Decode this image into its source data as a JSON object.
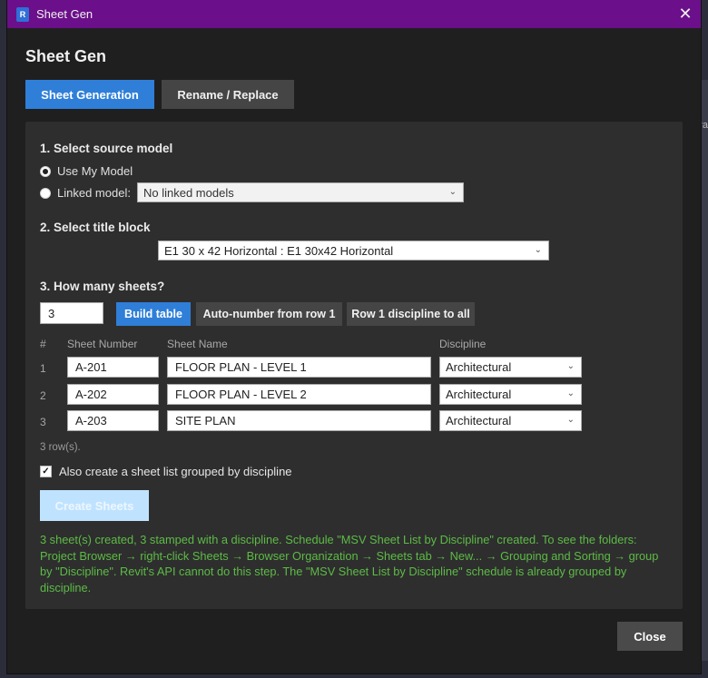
{
  "window": {
    "title": "Sheet Gen",
    "icon_letter": "R",
    "close_glyph": "✕"
  },
  "heading": "Sheet Gen",
  "tabs": [
    {
      "label": "Sheet Generation",
      "active": true
    },
    {
      "label": "Rename / Replace",
      "active": false
    }
  ],
  "section1": {
    "title": "1.  Select source model",
    "use_my_model": "Use My Model",
    "linked_model_label": "Linked model:",
    "linked_model_value": "No linked models",
    "selected": "use_my_model"
  },
  "section2": {
    "title": "2.  Select title block",
    "title_block_value": "E1 30 x 42 Horizontal : E1 30x42 Horizontal"
  },
  "section3": {
    "title": "3.  How many sheets?",
    "count_value": "3",
    "build_table": "Build table",
    "auto_number": "Auto-number from row 1",
    "row1_discipline": "Row 1 discipline to all"
  },
  "table": {
    "columns": {
      "num": "#",
      "sheet_number": "Sheet Number",
      "sheet_name": "Sheet Name",
      "discipline": "Discipline"
    },
    "rows": [
      {
        "num": "1",
        "sheet_number": "A-201",
        "sheet_name": "FLOOR PLAN - LEVEL 1",
        "discipline": "Architectural"
      },
      {
        "num": "2",
        "sheet_number": "A-202",
        "sheet_name": "FLOOR PLAN - LEVEL 2",
        "discipline": "Architectural"
      },
      {
        "num": "3",
        "sheet_number": "A-203",
        "sheet_name": "SITE PLAN",
        "discipline": "Architectural"
      }
    ],
    "row_count": "3 row(s)."
  },
  "options": {
    "sheet_list_label": "Also create a sheet list grouped by discipline",
    "sheet_list_checked": true
  },
  "create_button": "Create Sheets",
  "status_message": "3 sheet(s) created, 3 stamped with a discipline.   Schedule \"MSV Sheet List by Discipline\" created.   To see the folders: Project Browser → right-click Sheets → Browser Organization → Sheets tab → New... → Grouping and Sorting → group by \"Discipline\". Revit's API cannot do this step. The \"MSV Sheet List by Discipline\" schedule is already grouped by discipline.",
  "close_button": "Close",
  "colors": {
    "titlebar": "#6b0f8a",
    "accent": "#2f7fd8",
    "status_green": "#5dbb46"
  },
  "background_fragment": "ra"
}
